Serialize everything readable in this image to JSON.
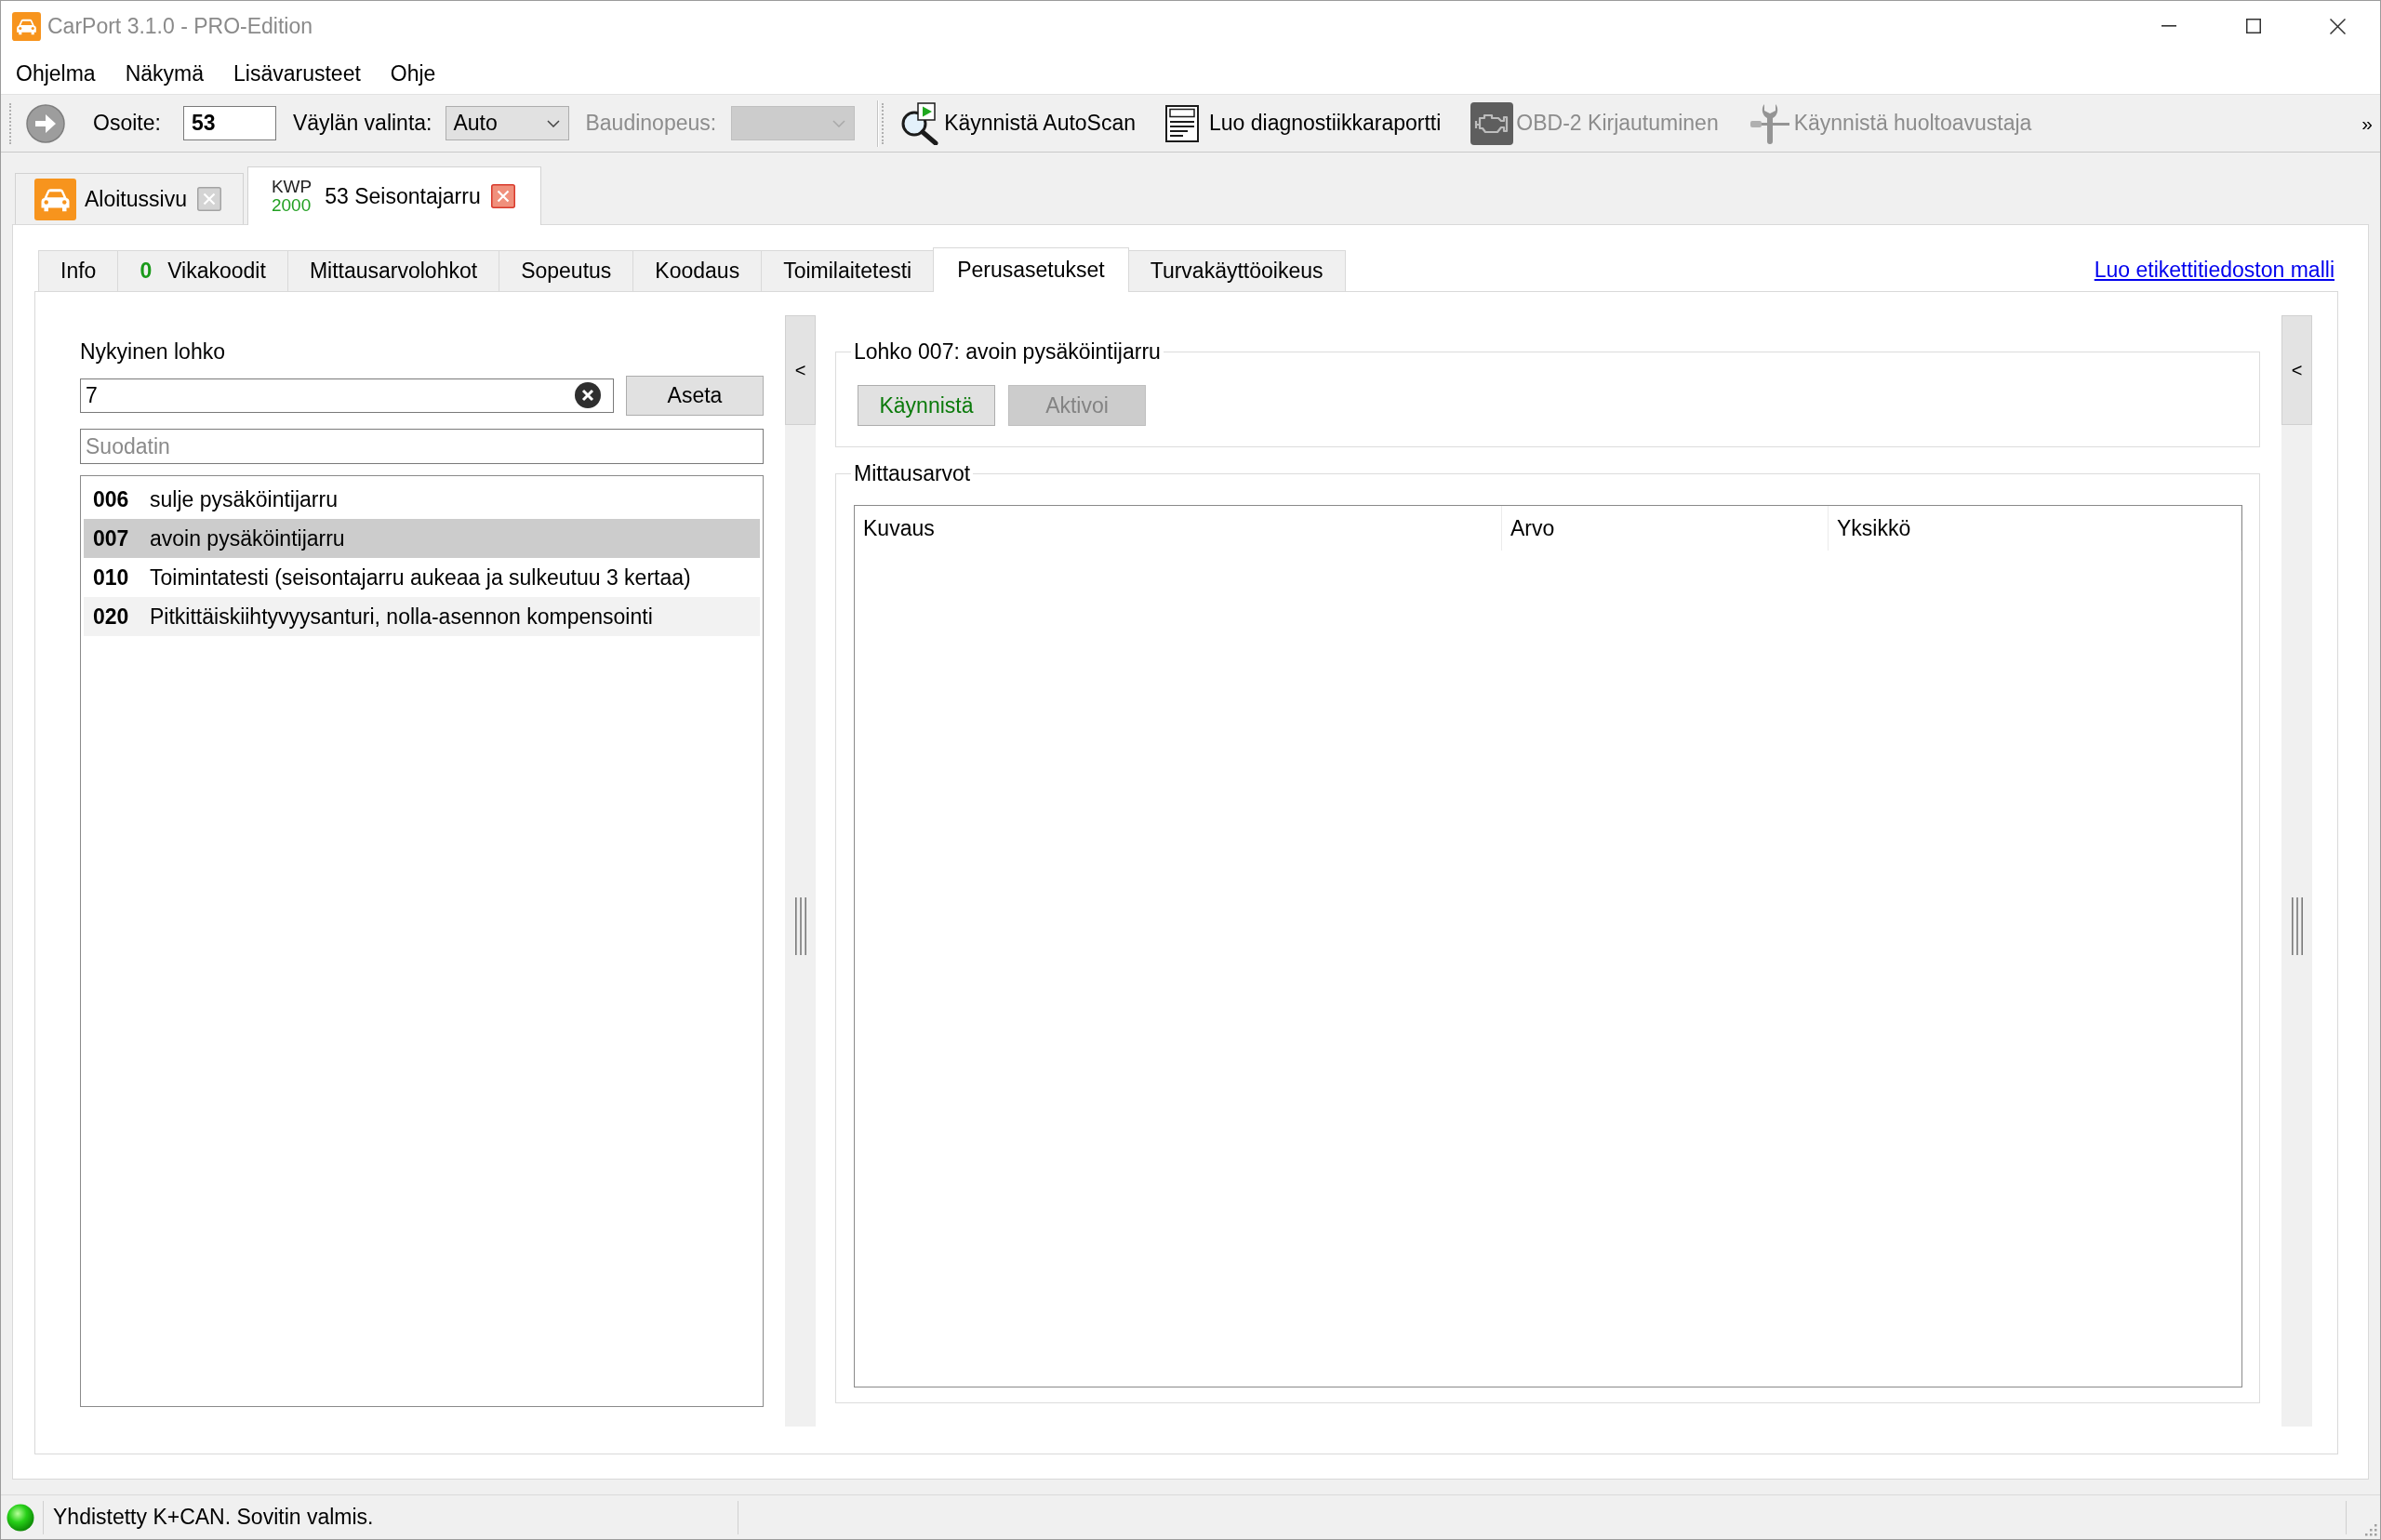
{
  "window": {
    "title": "CarPort 3.1.0 - PRO-Edition"
  },
  "menu": [
    {
      "label": "Ohjelma"
    },
    {
      "label": "Näkymä"
    },
    {
      "label": "Lisävarusteet"
    },
    {
      "label": "Ohje"
    }
  ],
  "toolbar": {
    "address": {
      "label": "Osoite:",
      "value": "53"
    },
    "bus": {
      "label": "Väylän valinta:",
      "value": "Auto",
      "disabled": false
    },
    "baud": {
      "label": "Baudinopeus:",
      "disabled": true
    },
    "actions": [
      {
        "kind": "autoscan",
        "label": "Käynnistä AutoScan",
        "disabled": false
      },
      {
        "kind": "report",
        "label": "Luo diagnostiikkaraportti",
        "disabled": false
      },
      {
        "kind": "engine",
        "label": "OBD-2 Kirjautuminen",
        "disabled": true
      },
      {
        "kind": "service",
        "label": "Käynnistä huoltoavustaja",
        "disabled": true
      }
    ],
    "overflow": "»"
  },
  "document_tabs": [
    {
      "kind": "home",
      "label": "Aloitussivu",
      "selected": false
    },
    {
      "kind": "module",
      "protocol": [
        "KWP",
        "2000"
      ],
      "label": "53 Seisontajarru",
      "selected": true
    }
  ],
  "tabs": [
    {
      "label": "Info",
      "selected": false
    },
    {
      "label": "Vikakoodit",
      "count": "0",
      "selected": false
    },
    {
      "label": "Mittausarvolohkot",
      "selected": false
    },
    {
      "label": "Sopeutus",
      "selected": false
    },
    {
      "label": "Koodaus",
      "selected": false
    },
    {
      "label": "Toimilaitetesti",
      "selected": false
    },
    {
      "label": "Perusasetukset",
      "selected": true
    },
    {
      "label": "Turvakäyttöoikeus",
      "selected": false
    }
  ],
  "template_link": "Luo etikettitiedoston malli",
  "block_panel": {
    "label": "Nykyinen lohko",
    "value": "7",
    "set_button": "Aseta",
    "filter_placeholder": "Suodatin",
    "blocks": [
      {
        "code": "006",
        "name": "sulje pysäköintijarru",
        "selected": false
      },
      {
        "code": "007",
        "name": "avoin pysäköintijarru",
        "selected": true
      },
      {
        "code": "010",
        "name": "Toimintatesti (seisontajarru aukeaa ja sulkeutuu 3 kertaa)",
        "selected": false
      },
      {
        "code": "020",
        "name": "Pitkittäiskiihtyvyysanturi, nolla-asennon kompensointi",
        "selected": false
      }
    ]
  },
  "splitters": [
    {
      "button": "<"
    },
    {
      "button": "<"
    }
  ],
  "basic_settings": {
    "title": "Lohko 007: avoin pysäköintijarru",
    "buttons": [
      {
        "kind": "start",
        "label": "Käynnistä",
        "disabled": false
      },
      {
        "kind": "activate",
        "label": "Aktivoi",
        "disabled": true
      }
    ]
  },
  "measurements": {
    "title": "Mittausarvot",
    "columns": [
      "Kuvaus",
      "Arvo",
      "Yksikkö"
    ]
  },
  "status_bar": {
    "connected": true,
    "text": "Yhdistetty K+CAN. Sovitin valmis."
  }
}
